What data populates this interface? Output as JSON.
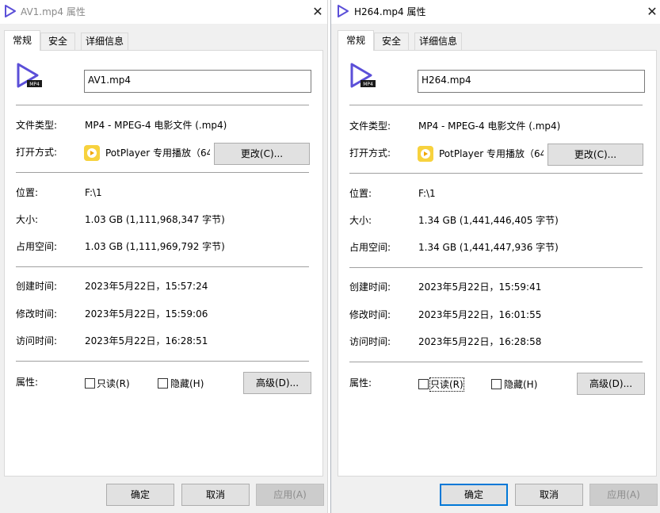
{
  "windows": [
    {
      "title": "AV1.mp4 属性",
      "tabs": [
        "常规",
        "安全",
        "详细信息"
      ],
      "file_name": "AV1.mp4",
      "file_icon_label": "MP4",
      "labels": {
        "type": "文件类型:",
        "opens_with": "打开方式:",
        "location": "位置:",
        "size": "大小:",
        "size_on_disk": "占用空间:",
        "created": "创建时间:",
        "modified": "修改时间:",
        "accessed": "访问时间:",
        "attributes": "属性:"
      },
      "values": {
        "type": "MP4 - MPEG-4 电影文件 (.mp4)",
        "opens_with": "PotPlayer 专用播放（64",
        "location": "F:\\1",
        "size": "1.03 GB (1,111,968,347 字节)",
        "size_on_disk": "1.03 GB (1,111,969,792 字节)",
        "created": "2023年5月22日，15:57:24",
        "modified": "2023年5月22日，15:59:06",
        "accessed": "2023年5月22日，16:28:51"
      },
      "change_button": "更改(C)...",
      "attr_readonly": "只读(R)",
      "attr_hidden": "隐藏(H)",
      "advanced_button": "高级(D)...",
      "ok_button": "确定",
      "cancel_button": "取消",
      "apply_button": "应用(A)"
    },
    {
      "title": "H264.mp4 属性",
      "tabs": [
        "常规",
        "安全",
        "详细信息"
      ],
      "file_name": "H264.mp4",
      "file_icon_label": "MP4",
      "labels": {
        "type": "文件类型:",
        "opens_with": "打开方式:",
        "location": "位置:",
        "size": "大小:",
        "size_on_disk": "占用空间:",
        "created": "创建时间:",
        "modified": "修改时间:",
        "accessed": "访问时间:",
        "attributes": "属性:"
      },
      "values": {
        "type": "MP4 - MPEG-4 电影文件 (.mp4)",
        "opens_with": "PotPlayer 专用播放（64",
        "location": "F:\\1",
        "size": "1.34 GB (1,441,446,405 字节)",
        "size_on_disk": "1.34 GB (1,441,447,936 字节)",
        "created": "2023年5月22日，15:59:41",
        "modified": "2023年5月22日，16:01:55",
        "accessed": "2023年5月22日，16:28:58"
      },
      "change_button": "更改(C)...",
      "attr_readonly": "只读(R)",
      "attr_hidden": "隐藏(H)",
      "advanced_button": "高级(D)...",
      "ok_button": "确定",
      "cancel_button": "取消",
      "apply_button": "应用(A)"
    }
  ],
  "colors": {
    "accent": "#0078d7",
    "icon_purple": "#5b4fd8",
    "potplayer_yellow": "#f7d23e"
  }
}
